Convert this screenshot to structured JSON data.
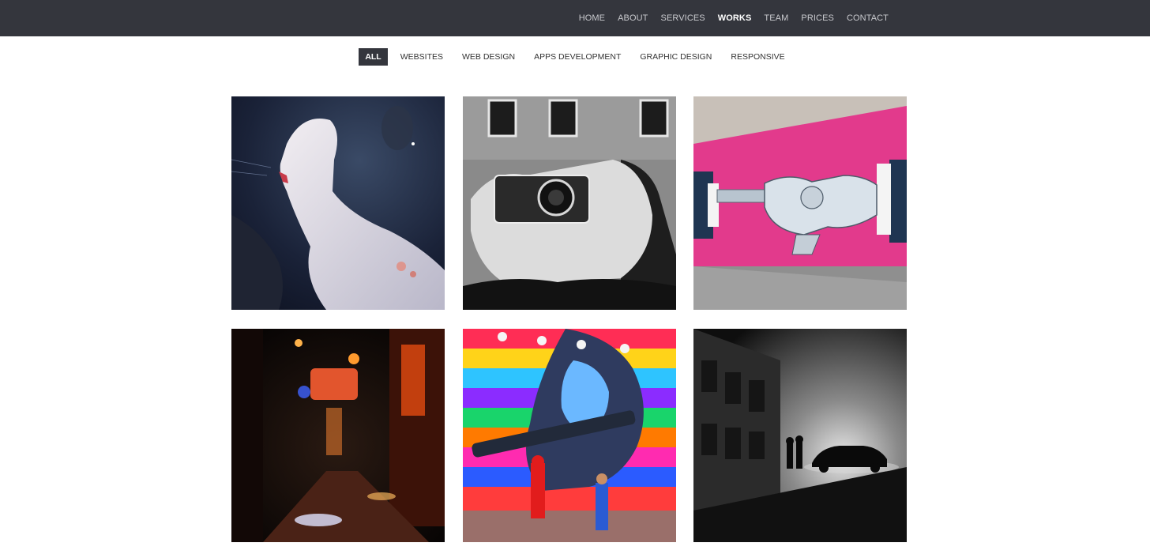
{
  "nav": {
    "items": [
      {
        "label": "HOME",
        "active": false
      },
      {
        "label": "ABOUT",
        "active": false
      },
      {
        "label": "SERVICES",
        "active": false
      },
      {
        "label": "WORKS",
        "active": true
      },
      {
        "label": "TEAM",
        "active": false
      },
      {
        "label": "PRICES",
        "active": false
      },
      {
        "label": "CONTACT",
        "active": false
      }
    ]
  },
  "filters": {
    "items": [
      {
        "label": "ALL",
        "active": true
      },
      {
        "label": "WEBSITES",
        "active": false
      },
      {
        "label": "WEB DESIGN",
        "active": false
      },
      {
        "label": "APPS DEVELOPMENT",
        "active": false
      },
      {
        "label": "GRAPHIC DESIGN",
        "active": false
      },
      {
        "label": "RESPONSIVE",
        "active": false
      }
    ]
  },
  "portfolio": {
    "items": [
      {
        "icon": "surreal-portrait-image"
      },
      {
        "icon": "camera-mural-image"
      },
      {
        "icon": "handshake-gun-mural-image"
      },
      {
        "icon": "night-alley-image"
      },
      {
        "icon": "colorful-soldier-mural-image"
      },
      {
        "icon": "foggy-street-car-image"
      }
    ]
  },
  "colors": {
    "topbar": "#34363d",
    "accent_pink": "#e23a8c"
  }
}
